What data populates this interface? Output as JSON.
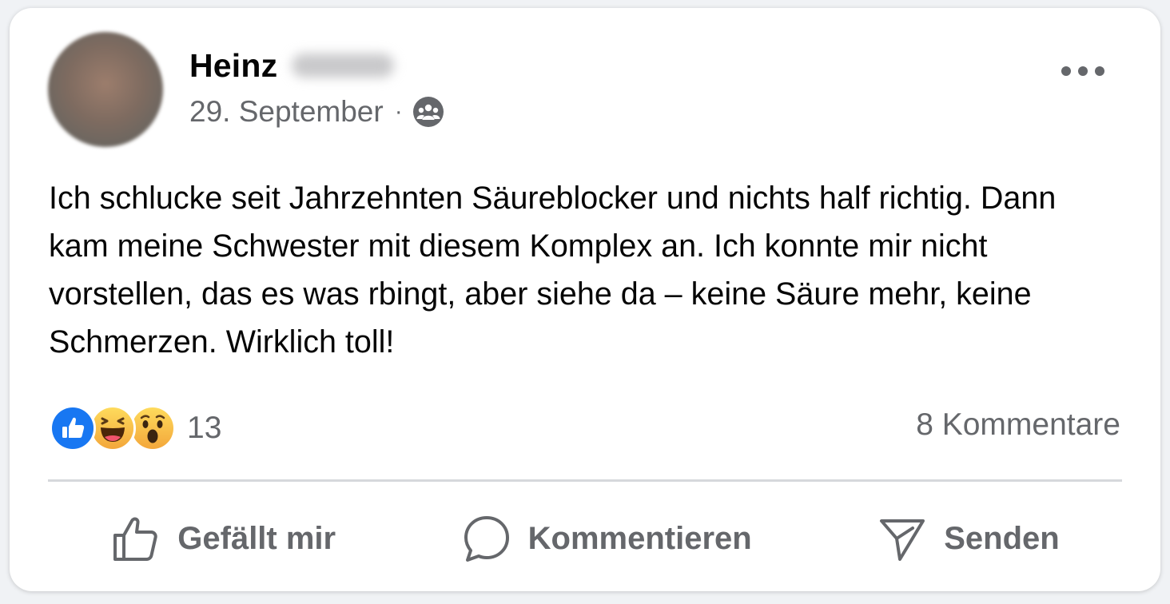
{
  "post": {
    "author_first_name": "Heinz",
    "date": "29. September",
    "separator": "·",
    "audience_icon": "group-audience-icon",
    "more_icon": "more-horizontal-icon",
    "text": "Ich schlucke seit Jahrzehnten Säureblocker und nichts half richtig. Dann kam meine Schwester mit diesem Komplex an. Ich konnte mir nicht vorstellen, das es was rbingt, aber siehe da – keine Säure mehr, keine Schmerzen. Wirklich toll!"
  },
  "engagement": {
    "reaction_icons": [
      "like-reaction-icon",
      "haha-reaction-icon",
      "wow-reaction-icon"
    ],
    "reaction_count": "13",
    "comments_label": "8 Kommentare"
  },
  "actions": {
    "like_label": "Gefällt mir",
    "comment_label": "Kommentieren",
    "send_label": "Senden"
  },
  "colors": {
    "like_blue": "#1877f2",
    "reaction_yellow": "#f7b928",
    "secondary_text": "#65676b",
    "primary_text": "#050505"
  }
}
